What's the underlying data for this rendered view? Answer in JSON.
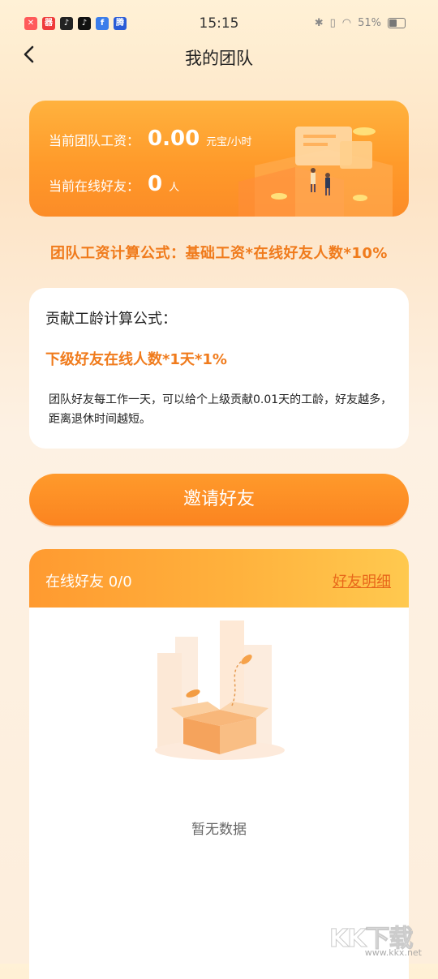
{
  "status_bar": {
    "time": "15:15",
    "battery": "51%",
    "app_icons": [
      {
        "name": "app-icon-1",
        "glyph": "✕",
        "color": "#ff5a5a"
      },
      {
        "name": "app-icon-2",
        "glyph": "器",
        "color": "#ef3b3b"
      },
      {
        "name": "tiktok-icon",
        "glyph": "♪",
        "color": "#222222"
      },
      {
        "name": "tiktok-icon-2",
        "glyph": "♪",
        "color": "#111111"
      },
      {
        "name": "facebook-icon",
        "glyph": "f",
        "color": "#3b7dea"
      },
      {
        "name": "app-icon-6",
        "glyph": "腾",
        "color": "#2a5bd7"
      }
    ]
  },
  "nav": {
    "title": "我的团队"
  },
  "salary_card": {
    "salary_label": "当前团队工资：",
    "salary_value": "0.00",
    "salary_unit": "元宝/小时",
    "online_label": "当前在线好友：",
    "online_value": "0",
    "online_unit": "人"
  },
  "team_formula": "团队工资计算公式：基础工资*在线好友人数*10%",
  "rule_card": {
    "title": "贡献工龄计算公式：",
    "formula": "下级好友在线人数*1天*1%",
    "description": "团队好友每工作一天，可以给个上级贡献0.01天的工龄，好友越多，距离退休时间越短。"
  },
  "invite_button": "邀请好友",
  "friends_card": {
    "online_label": "在线好友 0/0",
    "detail_link": "好友明细",
    "empty_text": "暂无数据"
  },
  "watermark": {
    "brand": "KK下载",
    "url": "www.kkx.net"
  },
  "colors": {
    "accent_orange": "#f07b1c",
    "card_orange": "#ff9a2a",
    "link_orange": "#e8671a"
  }
}
